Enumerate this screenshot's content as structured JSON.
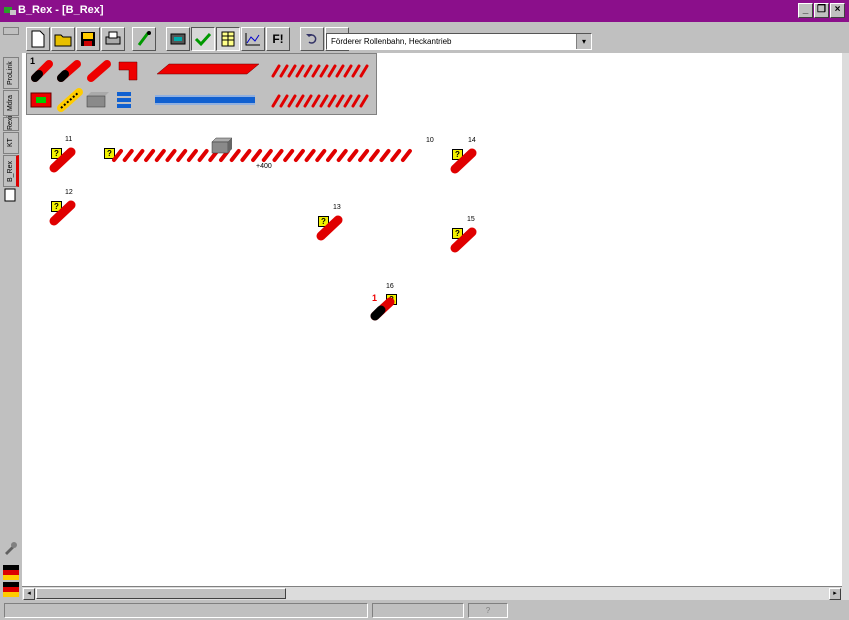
{
  "window": {
    "title": "B_Rex - [B_Rex]",
    "buttons": {
      "minimize": "_",
      "restore": "❐",
      "close": "×"
    }
  },
  "toolbar": {
    "function_button_label": "F!",
    "component_select": {
      "value": "Förderer Rollenbahn, Heckantrieb"
    },
    "dropdown_arrow": "▾"
  },
  "left_tabs": [
    "ProLink",
    "Mdra",
    "Rexi",
    "KT",
    "B_Rex"
  ],
  "palette": {
    "row1_marker": "1"
  },
  "canvas": {
    "elements": [
      {
        "id": "11"
      },
      {
        "id": "12"
      },
      {
        "id": "10"
      },
      {
        "id": "13"
      },
      {
        "id": "14"
      },
      {
        "id": "15"
      },
      {
        "id": "16",
        "marker": "1"
      }
    ],
    "conveyor_label": "+400",
    "question_mark": "?"
  },
  "scrollbar": {
    "left_arrow": "◂",
    "right_arrow": "▸"
  },
  "statusbar": {
    "panel3": "?"
  },
  "colors": {
    "title_bar": "#8b0f8b",
    "conveyor_red": "#e00000",
    "marker_yellow": "#f2f200",
    "canvas": "#ffffff"
  }
}
